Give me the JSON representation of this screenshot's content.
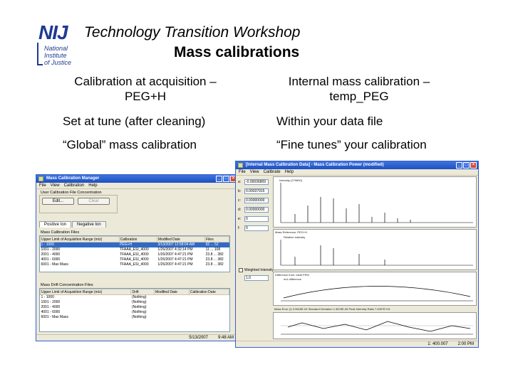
{
  "header": {
    "logo_mark": "NIJ",
    "logo_lines": [
      "National",
      "Institute",
      "of Justice"
    ],
    "title": "Technology Transition Workshop",
    "subtitle": "Mass calibrations"
  },
  "left_column": {
    "heading": "Calibration at acquisition – PEG+H",
    "line2": "Set at tune (after cleaning)",
    "line3": "“Global” mass calibration"
  },
  "right_column": {
    "heading": "Internal mass calibration – temp_PEG",
    "line2": "Within your data file",
    "line3": "“Fine tunes” your calibration"
  },
  "mass_calibration_manager": {
    "title": "Mass Calibration Manager",
    "menu": [
      "File",
      "View",
      "Calibration",
      "Help"
    ],
    "group_label": "User Calibration File Concentration",
    "edit_button": "Edit...",
    "clear_button": "Clear",
    "tabs": [
      "Positive Ion",
      "Negative Ion"
    ],
    "table1_label": "Mass Calibration Files",
    "table1_columns": [
      "Upper Limit of Acquisition Range (m/z)",
      "Calibration",
      "Modified Date",
      "Files"
    ],
    "table1_rows": [
      [
        "1 - 1000",
        "PEG+H",
        "3/13/2007 12:58:04 AM",
        "92 ... 52"
      ],
      [
        "1001 - 2000",
        "TFAAA_ESI_4000",
        "1/26/2007 4:32:14 PM",
        "11 ... 108"
      ],
      [
        "2001 - 4000",
        "TFAAA_ESI_4000",
        "1/26/2007 4:47:21 PM",
        "23.8 ... 382"
      ],
      [
        "4001 - 6000",
        "TFAAA_ESI_4000",
        "1/26/2007 4:47:21 PM",
        "23.8 ... 382"
      ],
      [
        "6001 - Max Mass",
        "TFAAA_ESI_4000",
        "1/26/2007 4:47:21 PM",
        "23.8 ... 382"
      ]
    ],
    "table2_label": "Mass Drift Concentration Files",
    "table2_columns": [
      "Upper Limit of Acquisition Range (m/z)",
      "Drift",
      "Modified Date",
      "Calibration Date"
    ],
    "table2_rows": [
      [
        "1 - 1000",
        "(Nothing)"
      ],
      [
        "1001 - 2000",
        "(Nothing)"
      ],
      [
        "2001 - 4000",
        "(Nothing)"
      ],
      [
        "4001 - 6000",
        "(Nothing)"
      ],
      [
        "6001 - Max Mass",
        "(Nothing)"
      ]
    ],
    "status": [
      "5/13/2007",
      "9:48 AM"
    ]
  },
  "internal_calibration": {
    "title": "[Internal Mass Calibration Data] - Mass Calibration Power (modified)",
    "menu": [
      "File",
      "View",
      "Calibrate",
      "Help"
    ],
    "labels": [
      "a:",
      "b:",
      "c:",
      "d:",
      "e:",
      "f:"
    ],
    "values": [
      "-0.00036809",
      "0.00037915",
      "0.00000000",
      "0.00000000",
      "0",
      "0"
    ],
    "spectrum_label": "Intensity (279890)",
    "reference_label": "Mass Reference: PEG+H",
    "relative_label": "Relative intensity",
    "weighted_label": "Weighted Intensity",
    "weighted_value": "1.0",
    "err_label": "Difference from: ideal PPM",
    "err_sub": "m/z difference",
    "bottom_label": "Mass Error (r) 3.9618E-04   Standard Deviation 1.3878E-06   Peak Intensity Ratio 7.6397E+01",
    "status": [
      "1: 400.007",
      "2:00 PM"
    ]
  }
}
